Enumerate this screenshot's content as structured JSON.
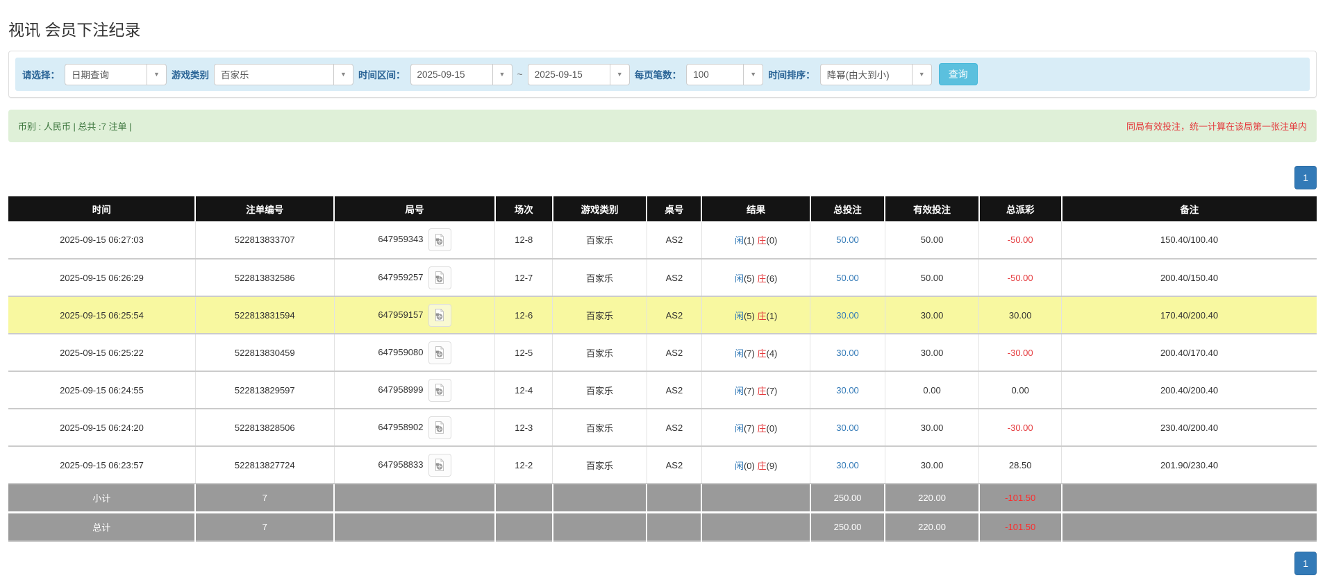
{
  "page": {
    "title": "视讯 会员下注纪录"
  },
  "filters": {
    "select_label": "请选择：",
    "select_value": "日期查询",
    "game_label": "游戏类别",
    "game_value": "百家乐",
    "range_label": "时间区间：",
    "range_from": "2025-09-15",
    "range_tilde": "~",
    "range_to": "2025-09-15",
    "per_page_label": "每页笔数：",
    "per_page_value": "100",
    "sort_label": "时间排序：",
    "sort_value": "降幂(由大到小)",
    "search_label": "查询",
    "caret_icon": "▼",
    "accent_color": "#d9edf7",
    "button_color": "#5bc0de"
  },
  "summary": {
    "left": "币别 : 人民币 | 总共 :7 注单 |",
    "right": "同局有效投注，统一计算在该局第一张注单内",
    "bg_color": "#dff0d8",
    "left_color": "#3c763d",
    "right_color": "#e4393c"
  },
  "pagination": {
    "page": "1",
    "color": "#337ab7"
  },
  "table": {
    "headers": [
      "时间",
      "注单编号",
      "局号",
      "场次",
      "游戏类别",
      "桌号",
      "结果",
      "总投注",
      "有效投注",
      "总派彩",
      "备注"
    ],
    "header_bg": "#141414",
    "highlight_color": "#f8f8a0",
    "video_icon": "video-record-icon",
    "rows": [
      {
        "time": "2025-09-15 06:27:03",
        "bet_no": "522813833707",
        "round_no": "647959343",
        "session": "12-8",
        "game": "百家乐",
        "table_no": "AS2",
        "player_label": "闲",
        "player_count": "(1)",
        "banker_label": "庄",
        "banker_count": "(0)",
        "total_bet": "50.00",
        "valid_bet": "50.00",
        "payout": "-50.00",
        "note": "150.40/100.40",
        "highlight": false
      },
      {
        "time": "2025-09-15 06:26:29",
        "bet_no": "522813832586",
        "round_no": "647959257",
        "session": "12-7",
        "game": "百家乐",
        "table_no": "AS2",
        "player_label": "闲",
        "player_count": "(5)",
        "banker_label": "庄",
        "banker_count": "(6)",
        "total_bet": "50.00",
        "valid_bet": "50.00",
        "payout": "-50.00",
        "note": "200.40/150.40",
        "highlight": false
      },
      {
        "time": "2025-09-15 06:25:54",
        "bet_no": "522813831594",
        "round_no": "647959157",
        "session": "12-6",
        "game": "百家乐",
        "table_no": "AS2",
        "player_label": "闲",
        "player_count": "(5)",
        "banker_label": "庄",
        "banker_count": "(1)",
        "total_bet": "30.00",
        "valid_bet": "30.00",
        "payout": "30.00",
        "note": "170.40/200.40",
        "highlight": true
      },
      {
        "time": "2025-09-15 06:25:22",
        "bet_no": "522813830459",
        "round_no": "647959080",
        "session": "12-5",
        "game": "百家乐",
        "table_no": "AS2",
        "player_label": "闲",
        "player_count": "(7)",
        "banker_label": "庄",
        "banker_count": "(4)",
        "total_bet": "30.00",
        "valid_bet": "30.00",
        "payout": "-30.00",
        "note": "200.40/170.40",
        "highlight": false
      },
      {
        "time": "2025-09-15 06:24:55",
        "bet_no": "522813829597",
        "round_no": "647958999",
        "session": "12-4",
        "game": "百家乐",
        "table_no": "AS2",
        "player_label": "闲",
        "player_count": "(7)",
        "banker_label": "庄",
        "banker_count": "(7)",
        "total_bet": "30.00",
        "valid_bet": "0.00",
        "payout": "0.00",
        "note": "200.40/200.40",
        "highlight": false
      },
      {
        "time": "2025-09-15 06:24:20",
        "bet_no": "522813828506",
        "round_no": "647958902",
        "session": "12-3",
        "game": "百家乐",
        "table_no": "AS2",
        "player_label": "闲",
        "player_count": "(7)",
        "banker_label": "庄",
        "banker_count": "(0)",
        "total_bet": "30.00",
        "valid_bet": "30.00",
        "payout": "-30.00",
        "note": "230.40/200.40",
        "highlight": false
      },
      {
        "time": "2025-09-15 06:23:57",
        "bet_no": "522813827724",
        "round_no": "647958833",
        "session": "12-2",
        "game": "百家乐",
        "table_no": "AS2",
        "player_label": "闲",
        "player_count": "(0)",
        "banker_label": "庄",
        "banker_count": "(9)",
        "total_bet": "30.00",
        "valid_bet": "30.00",
        "payout": "28.50",
        "note": "201.90/230.40",
        "highlight": false
      }
    ],
    "subtotal": {
      "label": "小计",
      "count": "7",
      "total_bet": "250.00",
      "valid_bet": "220.00",
      "payout": "-101.50"
    },
    "total": {
      "label": "总计",
      "count": "7",
      "total_bet": "250.00",
      "valid_bet": "220.00",
      "payout": "-101.50"
    }
  }
}
